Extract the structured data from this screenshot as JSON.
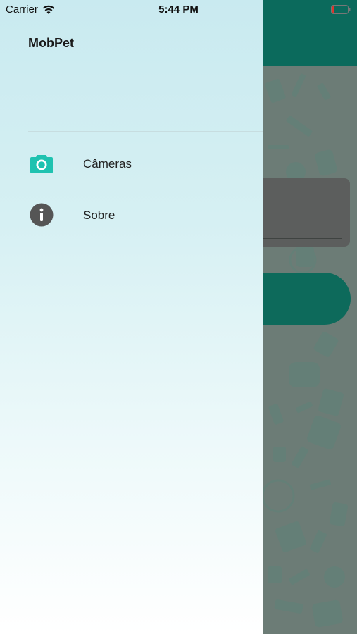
{
  "status_bar": {
    "carrier": "Carrier",
    "time": "5:44 PM",
    "wifi_icon": "wifi-icon",
    "battery_icon": "battery-low-icon",
    "battery_color": "#e0342b"
  },
  "drawer": {
    "title": "MobPet",
    "items": [
      {
        "label": "Câmeras",
        "icon": "camera-icon",
        "icon_color": "#1fc2b0"
      },
      {
        "label": "Sobre",
        "icon": "info-icon",
        "icon_color": "#555555"
      }
    ]
  },
  "background_app": {
    "header_color": "#0b6a5c",
    "overlay_color": "#6c7c76"
  }
}
